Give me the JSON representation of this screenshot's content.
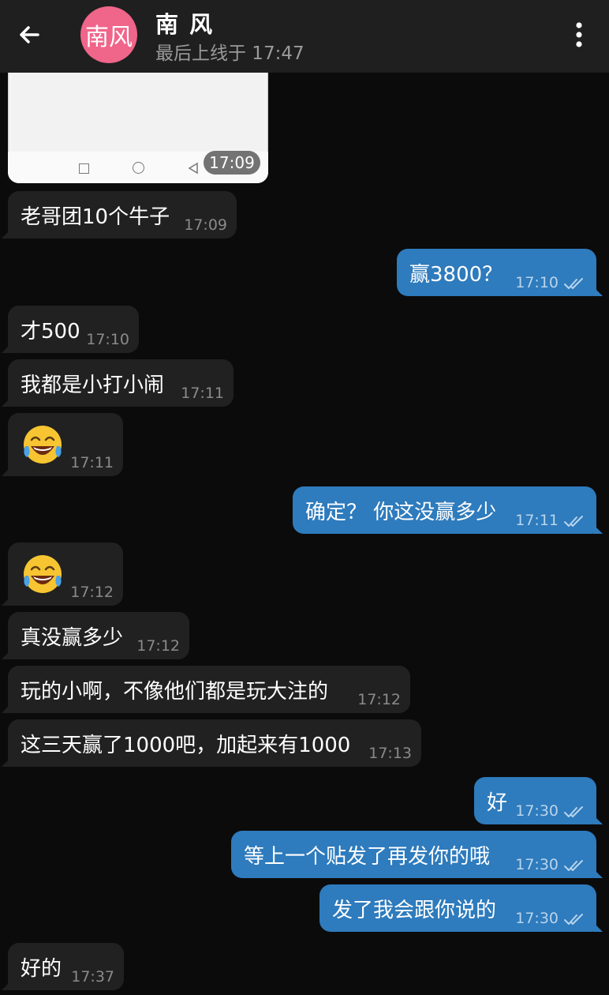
{
  "header": {
    "avatar_text": "南风",
    "name": "南 风",
    "status": "最后上线于 17:47"
  },
  "image_message": {
    "time": "17:09"
  },
  "messages": [
    {
      "dir": "in",
      "text": "老哥团10个牛子",
      "time": "17:09"
    },
    {
      "dir": "out",
      "text": "赢3800？",
      "time": "17:10"
    },
    {
      "dir": "in",
      "text": "才500",
      "time": "17:10"
    },
    {
      "dir": "in",
      "text": "我都是小打小闹",
      "time": "17:11"
    },
    {
      "dir": "in",
      "emoji": "face-with-tears-of-joy",
      "time": "17:11"
    },
    {
      "dir": "out",
      "text": "确定？ 你这没赢多少",
      "time": "17:11"
    },
    {
      "dir": "in",
      "emoji": "face-with-tears-of-joy",
      "time": "17:12"
    },
    {
      "dir": "in",
      "text": "真没赢多少",
      "time": "17:12"
    },
    {
      "dir": "in",
      "text": "玩的小啊，不像他们都是玩大注的",
      "time": "17:12"
    },
    {
      "dir": "in",
      "text": "这三天赢了1000吧，加起来有1000",
      "time": "17:13"
    },
    {
      "dir": "out",
      "text": "好",
      "time": "17:30"
    },
    {
      "dir": "out",
      "text": "等上一个贴发了再发你的哦",
      "time": "17:30"
    },
    {
      "dir": "out",
      "text": "发了我会跟你说的",
      "time": "17:30"
    },
    {
      "dir": "in",
      "text": "好的",
      "time": "17:37"
    }
  ],
  "colors": {
    "background": "#0b0b0b",
    "header": "#1f1f1f",
    "incoming_bubble": "#212121",
    "outgoing_bubble": "#2e7bbd",
    "avatar": "#f0658a"
  }
}
